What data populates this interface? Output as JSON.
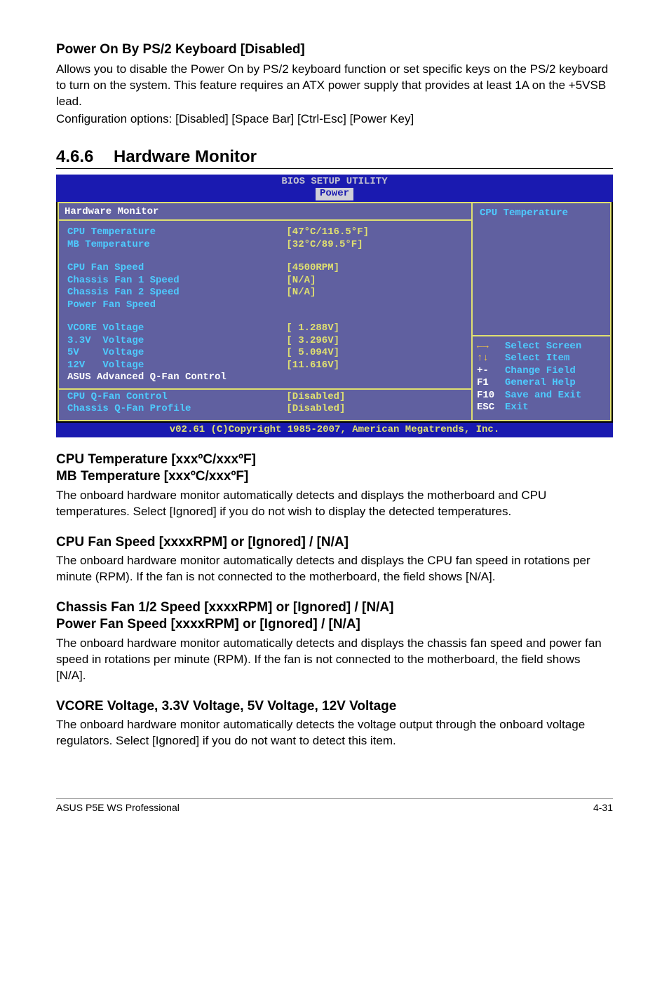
{
  "s1": {
    "title": "Power On By PS/2 Keyboard [Disabled]",
    "p1": "Allows you to disable the Power On by PS/2 keyboard function or set specific keys on the PS/2 keyboard to turn on the system. This feature requires an ATX power supply that provides at least 1A on the +5VSB lead.",
    "p2": "Configuration options: [Disabled] [Space Bar] [Ctrl-Esc] [Power Key]"
  },
  "sec": {
    "num": "4.6.6",
    "title": "Hardware Monitor"
  },
  "bios": {
    "title": "BIOS SETUP UTILITY",
    "tab": "Power",
    "panel_title": "Hardware Monitor",
    "group1": [
      {
        "label": "CPU Temperature",
        "value": "[47°C/116.5°F]"
      },
      {
        "label": "MB Temperature",
        "value": "[32°C/89.5°F]"
      }
    ],
    "group2": [
      {
        "label": "CPU Fan Speed",
        "value": "[4500RPM]"
      },
      {
        "label": "Chassis Fan 1 Speed",
        "value": "[N/A]"
      },
      {
        "label": "Chassis Fan 2 Speed",
        "value": "[N/A]"
      },
      {
        "label": "Power Fan Speed",
        "value": ""
      }
    ],
    "group3": [
      {
        "label": "VCORE Voltage",
        "value": "[ 1.288V]"
      },
      {
        "label": "3.3V  Voltage",
        "value": "[ 3.296V]"
      },
      {
        "label": "5V    Voltage",
        "value": "[ 5.094V]"
      },
      {
        "label": "12V   Voltage",
        "value": "[11.616V]"
      }
    ],
    "advanced": "ASUS Advanced Q-Fan Control",
    "group4": [
      {
        "label": "CPU Q-Fan Control",
        "value": "[Disabled]"
      },
      {
        "label": "Chassis Q-Fan Profile",
        "value": "[Disabled]"
      }
    ],
    "help_title": "CPU Temperature",
    "keys": [
      {
        "k": "←→",
        "d": "Select Screen",
        "arrows": true
      },
      {
        "k": "↑↓",
        "d": "Select Item",
        "arrows": true
      },
      {
        "k": "+-",
        "d": "Change Field"
      },
      {
        "k": "F1",
        "d": "General Help"
      },
      {
        "k": "F10",
        "d": "Save and Exit"
      },
      {
        "k": "ESC",
        "d": "Exit"
      }
    ],
    "footer": "v02.61 (C)Copyright 1985-2007, American Megatrends, Inc."
  },
  "s2": {
    "h1": "CPU Temperature [xxxºC/xxxºF]",
    "h2": "MB Temperature [xxxºC/xxxºF]",
    "p": "The onboard hardware monitor automatically detects and displays the motherboard and CPU temperatures. Select [Ignored] if you do not wish to display the detected temperatures."
  },
  "s3": {
    "h": "CPU Fan Speed [xxxxRPM] or [Ignored] / [N/A]",
    "p": "The onboard hardware monitor automatically detects and displays the CPU fan speed in rotations per minute (RPM). If the fan is not connected to the motherboard, the field shows [N/A]."
  },
  "s4": {
    "h1": "Chassis Fan 1/2 Speed [xxxxRPM] or [Ignored] / [N/A]",
    "h2": "Power Fan Speed [xxxxRPM] or [Ignored] / [N/A]",
    "p": "The onboard hardware monitor automatically detects and displays the chassis fan speed and power fan speed in rotations per minute (RPM). If the fan is not connected to the motherboard, the field shows [N/A]."
  },
  "s5": {
    "h": "VCORE Voltage, 3.3V Voltage, 5V Voltage, 12V Voltage",
    "p": "The onboard hardware monitor automatically detects the voltage output through the onboard voltage regulators. Select [Ignored] if you do not want to detect this item."
  },
  "footer": {
    "left": "ASUS P5E WS Professional",
    "right": "4-31"
  }
}
